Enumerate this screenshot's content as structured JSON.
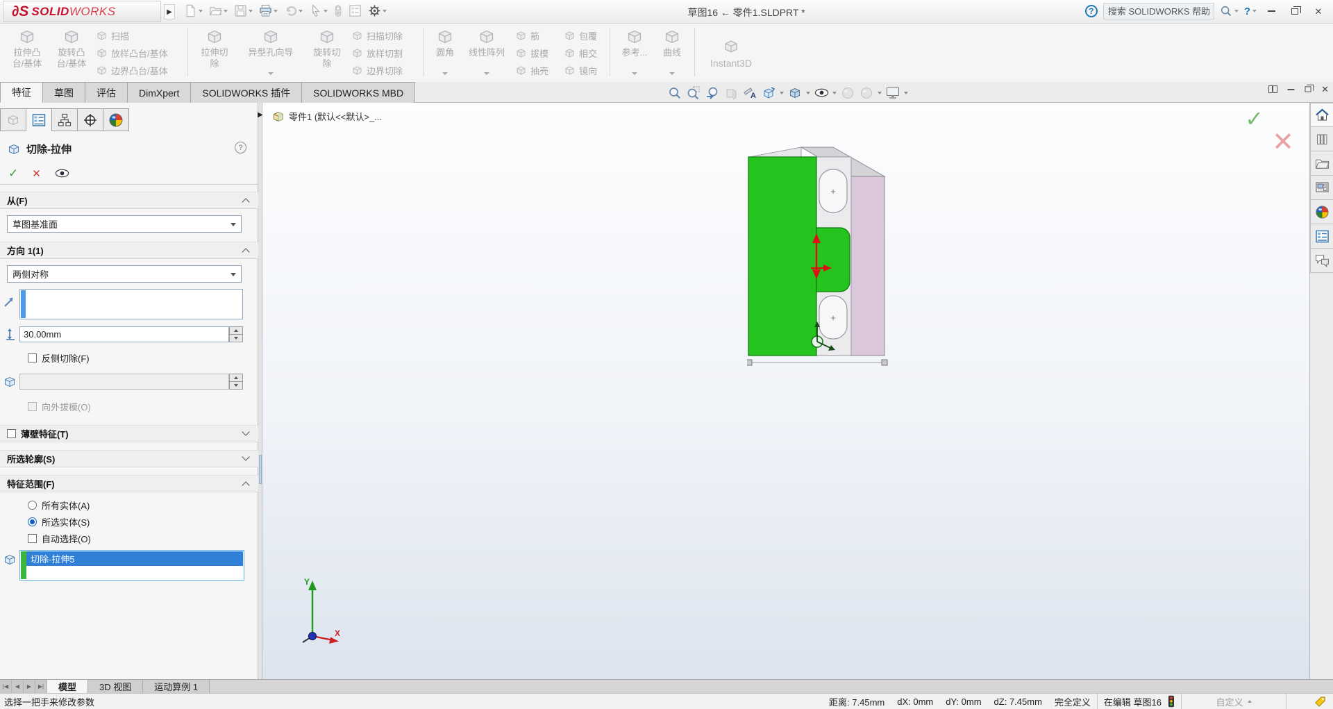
{
  "titlebar": {
    "logo_ds": "∂S",
    "logo_solid": "SOLID",
    "logo_works": "WORKS",
    "title": "草图16 ← 零件1.SLDPRT *",
    "search_placeholder": "搜索 SOLIDWORKS 帮助",
    "help_q": "?"
  },
  "ribbon": {
    "b1": [
      "拉伸凸",
      "台/基体"
    ],
    "b2": [
      "旋转凸",
      "台/基体"
    ],
    "s1": [
      "扫描",
      "放样凸台/基体",
      "边界凸台/基体"
    ],
    "b3": [
      "拉伸切",
      "除"
    ],
    "b4": "异型孔向导",
    "b5": [
      "旋转切",
      "除"
    ],
    "s2": [
      "扫描切除",
      "放样切割",
      "边界切除"
    ],
    "b6": "圆角",
    "b7": "线性阵列",
    "s3": [
      "筋",
      "拔模",
      "抽壳"
    ],
    "s4": [
      "包覆",
      "相交",
      "镜向"
    ],
    "b8": "参考...",
    "b9": "曲线",
    "b10": "Instant3D"
  },
  "tabs": [
    "特征",
    "草图",
    "评估",
    "DimXpert",
    "SOLIDWORKS 插件",
    "SOLIDWORKS MBD"
  ],
  "pm": {
    "title": "切除-拉伸",
    "help_q": "?",
    "from_label": "从(F)",
    "from_value": "草图基准面",
    "dir_label": "方向 1(1)",
    "dir_value": "两侧对称",
    "depth_value": "30.00mm",
    "flip_label": "反侧切除(F)",
    "outdraft_label": "向外拔模(O)",
    "thin_label": "薄壁特征(T)",
    "profiles_label": "所选轮廓(S)",
    "scope_label": "特征范围(F)",
    "scope_all": "所有实体(A)",
    "scope_selected": "所选实体(S)",
    "scope_auto": "自动选择(O)",
    "scope_item": "切除-拉伸5"
  },
  "viewport": {
    "breadcrumb": "零件1 (默认<<默认>_...",
    "slot_plus": "+",
    "triad_x": "X",
    "triad_y": "Y"
  },
  "bottom_tabs": [
    "模型",
    "3D 视图",
    "运动算例 1"
  ],
  "statusbar": {
    "left": "选择一把手来修改参数",
    "distance": "距离: 7.45mm",
    "dx": "dX: 0mm",
    "dy": "dY: 0mm",
    "dz": "dZ: 7.45mm",
    "state": "完全定义",
    "editing": "在编辑 草图16",
    "custom": "自定义"
  },
  "colors": {
    "selection_blue": "#2f80d6",
    "scope_green": "#3cb53c",
    "part_green": "#24c31e",
    "part_pink": "#dac7db",
    "confirm_green": "#79bd6e",
    "confirm_red": "#e7a2a2",
    "logo_red": "#c8102e"
  }
}
